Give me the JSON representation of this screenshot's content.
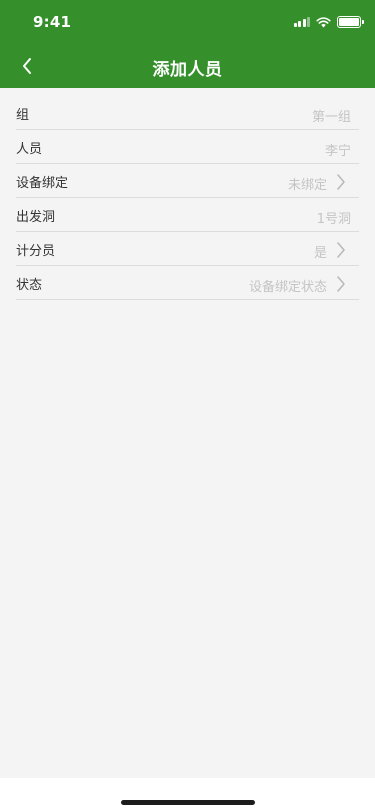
{
  "status_bar": {
    "time": "9:41",
    "battery_level": 1.0
  },
  "nav": {
    "title": "添加人员",
    "back_icon": "chevron-left-icon"
  },
  "form": {
    "rows": [
      {
        "label": "组",
        "value": "第一组",
        "chevron": false
      },
      {
        "label": "人员",
        "value": "李宁",
        "chevron": false
      },
      {
        "label": "设备绑定",
        "value": "未绑定",
        "chevron": true
      },
      {
        "label": "出发洞",
        "value": "1号洞",
        "chevron": false
      },
      {
        "label": "计分员",
        "value": "是",
        "chevron": true
      },
      {
        "label": "状态",
        "value": "设备绑定状态",
        "chevron": true
      }
    ]
  },
  "colors": {
    "header": "#35902c",
    "background": "#f4f4f4",
    "placeholder_text": "#c4c4c4",
    "label_text": "#333333"
  }
}
